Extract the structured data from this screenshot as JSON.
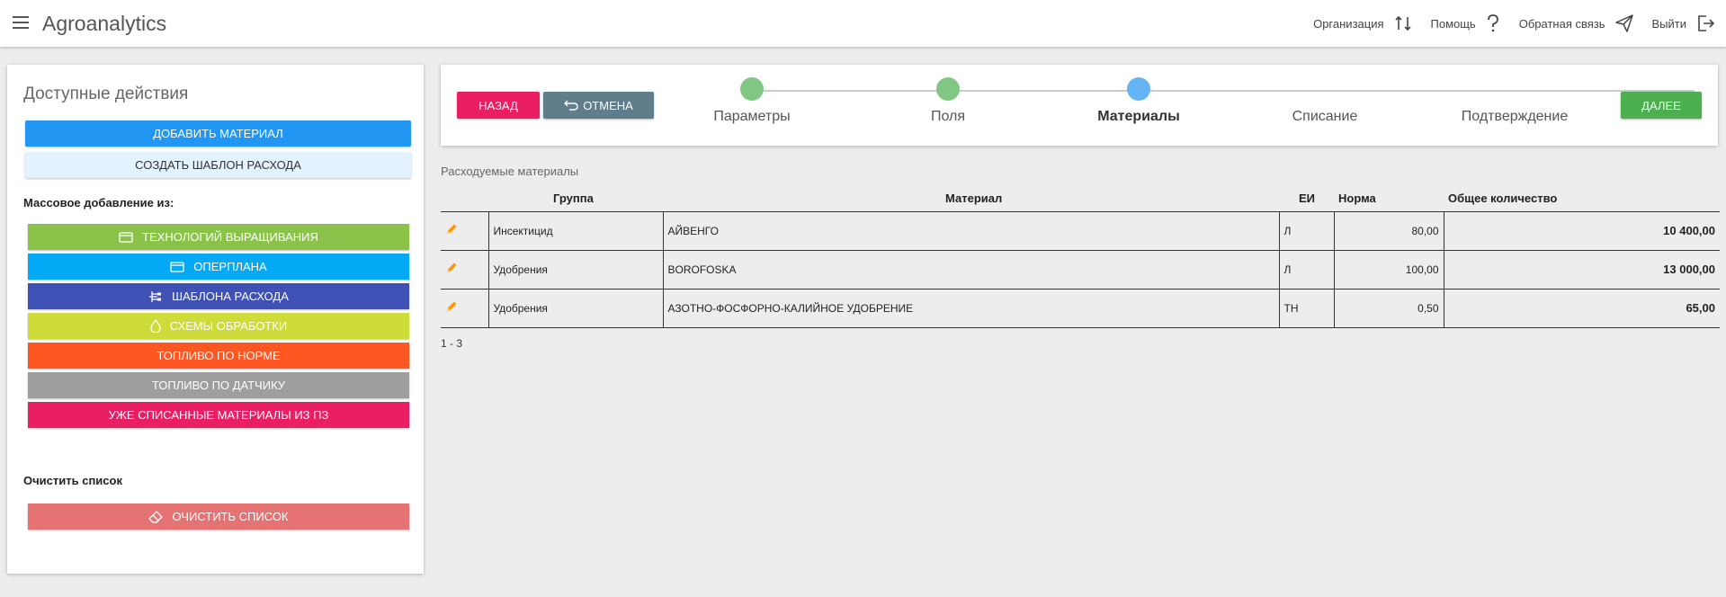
{
  "header": {
    "title": "Agroanalytics",
    "actions": [
      {
        "label": "Организация",
        "icon": "swap-vertical-icon"
      },
      {
        "label": "Помощь",
        "icon": "question-mark-icon"
      },
      {
        "label": "Обратная связь",
        "icon": "paper-plane-icon"
      },
      {
        "label": "Выйти",
        "icon": "logout-icon"
      }
    ]
  },
  "sidebar": {
    "title": "Доступные действия",
    "add_material": "ДОБАВИТЬ МАТЕРИАЛ",
    "create_template": "СОЗДАТЬ ШАБЛОН РАСХОДА",
    "mass_label": "Массовое добавление из:",
    "mass_buttons": [
      {
        "label": "ТЕХНОЛОГИЙ ВЫРАЩИВАНИЯ",
        "color": "#8bc34a",
        "icon": "card-icon"
      },
      {
        "label": "ОПЕРПЛАНА",
        "color": "#03a9f4",
        "icon": "card-icon"
      },
      {
        "label": "ШАБЛОНА РАСХОДА",
        "color": "#3f51b5",
        "icon": "tree-icon"
      },
      {
        "label": "СХЕМЫ ОБРАБОТКИ",
        "color": "#cddc39",
        "icon": "drop-icon"
      },
      {
        "label": "ТОПЛИВО ПО НОРМЕ",
        "color": "#ff5722",
        "icon": ""
      },
      {
        "label": "ТОПЛИВО ПО ДАТЧИКУ",
        "color": "#9e9e9e",
        "icon": ""
      },
      {
        "label": "УЖЕ СПИСАННЫЕ МАТЕРИАЛЫ ИЗ ПЗ",
        "color": "#e91e63",
        "icon": ""
      }
    ],
    "clear_label": "Очистить список",
    "clear_button": "ОЧИСТИТЬ СПИСОК"
  },
  "stepper": {
    "back": "НАЗАД",
    "cancel": "ОТМЕНА",
    "next": "ДАЛЕЕ",
    "steps": [
      {
        "label": "Параметры",
        "state": "done",
        "color": "#81c784"
      },
      {
        "label": "Поля",
        "state": "done",
        "color": "#81c784"
      },
      {
        "label": "Материалы",
        "state": "active",
        "color": "#64b5f6"
      },
      {
        "label": "Списание",
        "state": "pending",
        "color": ""
      },
      {
        "label": "Подтверждение",
        "state": "pending",
        "color": ""
      }
    ]
  },
  "materials": {
    "caption": "Расходуемые материалы",
    "columns": [
      "Группа",
      "Материал",
      "ЕИ",
      "Норма",
      "Общее количество"
    ],
    "rows": [
      {
        "group": "Инсектицид",
        "material": "АЙВЕНГО",
        "unit": "Л",
        "norm": "80,00",
        "total": "10 400,00"
      },
      {
        "group": "Удобрения",
        "material": "BOROFOSKA",
        "unit": "Л",
        "norm": "100,00",
        "total": "13 000,00"
      },
      {
        "group": "Удобрения",
        "material": "АЗОТНО-ФОСФОРНО-КАЛИЙНОЕ УДОБРЕНИЕ",
        "unit": "ТН",
        "norm": "0,50",
        "total": "65,00"
      }
    ],
    "pager": "1 - 3"
  }
}
